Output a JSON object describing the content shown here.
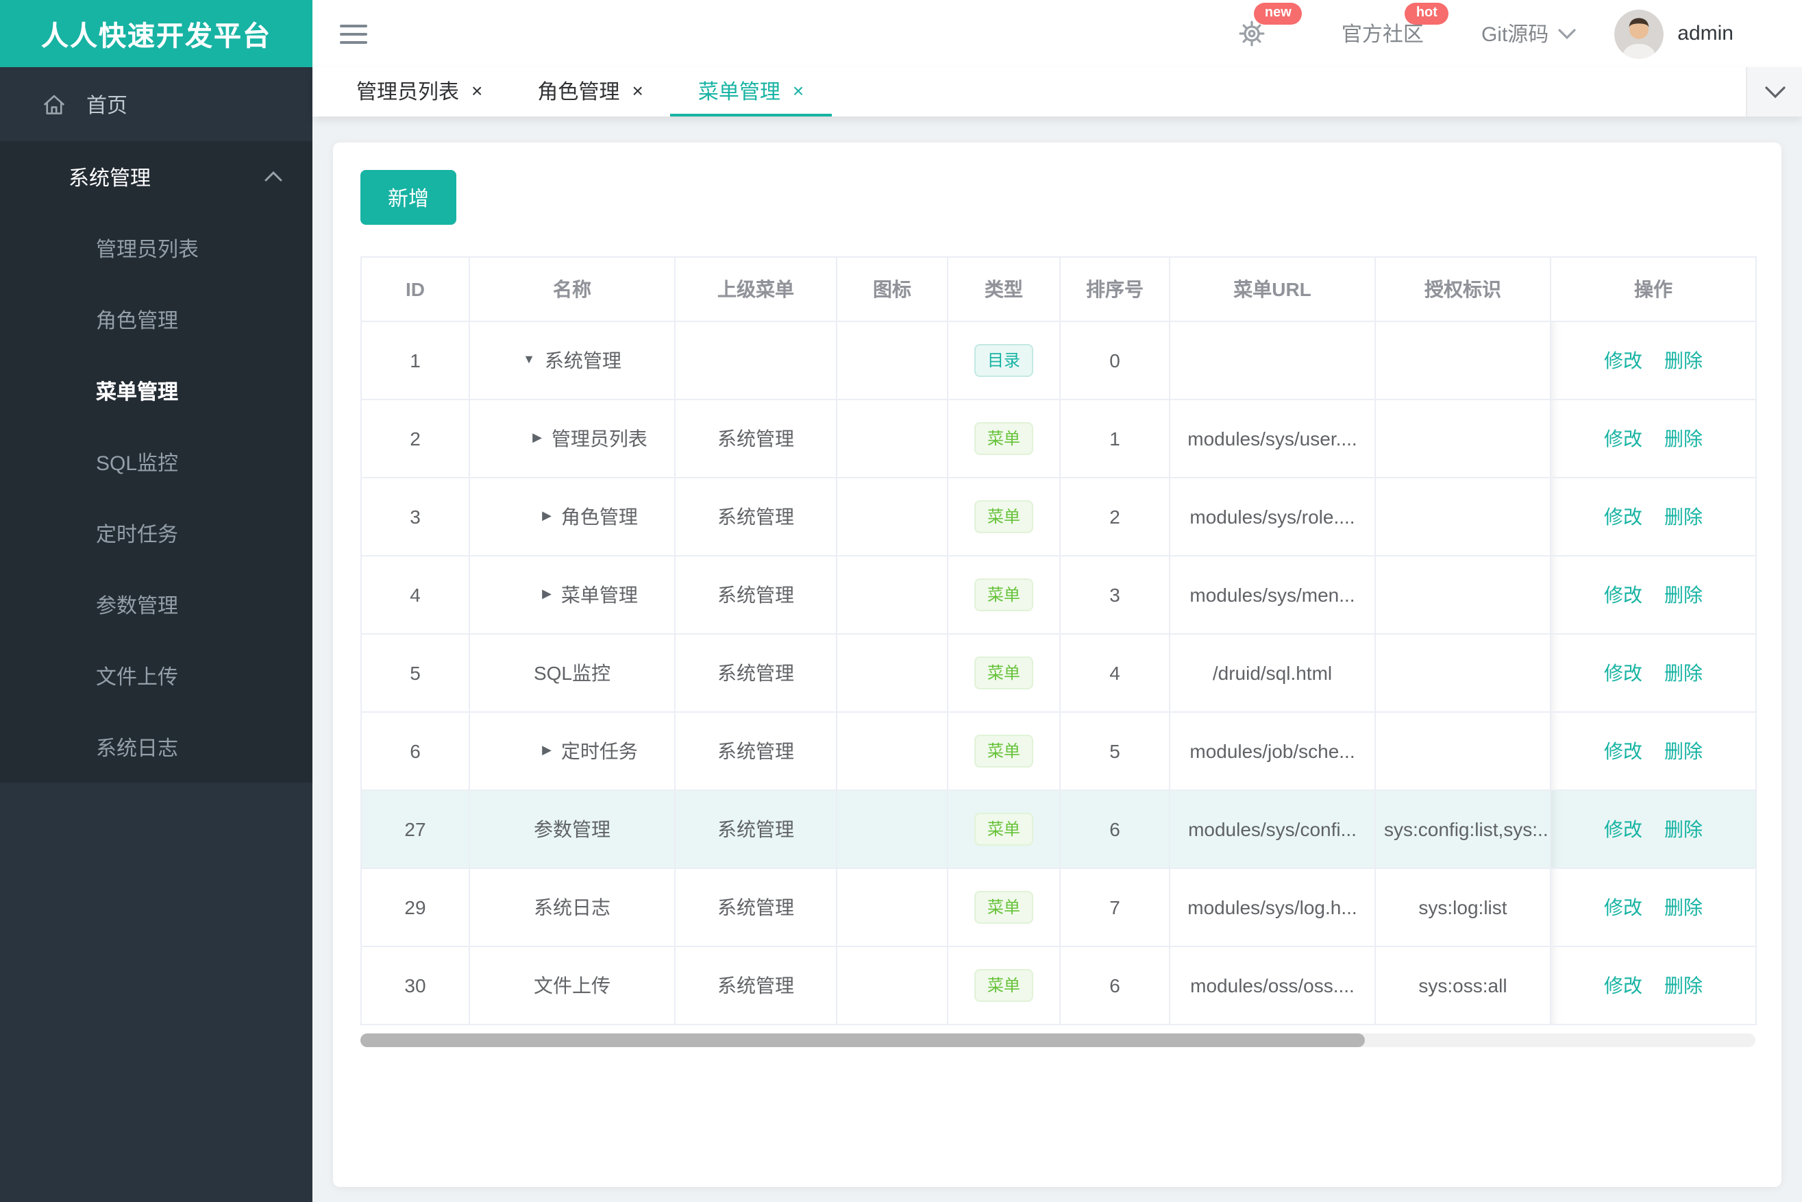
{
  "app": {
    "title": "人人快速开发平台"
  },
  "topbar": {
    "badge_new": "new",
    "community_label": "官方社区",
    "badge_hot": "hot",
    "git_label": "Git源码",
    "username": "admin"
  },
  "tabs": [
    {
      "label": "管理员列表",
      "active": false
    },
    {
      "label": "角色管理",
      "active": false
    },
    {
      "label": "菜单管理",
      "active": true
    }
  ],
  "sidebar": {
    "home_label": "首页",
    "group_label": "系统管理",
    "items": [
      "管理员列表",
      "角色管理",
      "菜单管理",
      "SQL监控",
      "定时任务",
      "参数管理",
      "文件上传",
      "系统日志"
    ],
    "active_item": "菜单管理"
  },
  "toolbar": {
    "add_label": "新增"
  },
  "actions": {
    "edit": "修改",
    "delete": "删除"
  },
  "glyphs": {
    "close": "×",
    "expanded": "▼",
    "collapsed": "▶"
  },
  "table": {
    "columns": [
      {
        "label": "ID",
        "width": 79
      },
      {
        "label": "名称",
        "width": 150
      },
      {
        "label": "上级菜单",
        "width": 118
      },
      {
        "label": "图标",
        "width": 81
      },
      {
        "label": "类型",
        "width": 82
      },
      {
        "label": "排序号",
        "width": 80
      },
      {
        "label": "菜单URL",
        "width": 150
      },
      {
        "label": "授权标识",
        "width": 128
      },
      {
        "label": "操作",
        "width": 150
      }
    ],
    "rows": [
      {
        "id": "1",
        "expand": "expanded",
        "name": "系统管理",
        "parent": "",
        "icon": "",
        "type": "目录",
        "type_variant": "dir",
        "order": "0",
        "url": "",
        "perms": "",
        "highlighted": false
      },
      {
        "id": "2",
        "expand": "collapsed",
        "name": "管理员列表",
        "parent": "系统管理",
        "icon": "",
        "type": "菜单",
        "type_variant": "menu",
        "order": "1",
        "url": "modules/sys/user....",
        "perms": "",
        "highlighted": false
      },
      {
        "id": "3",
        "expand": "collapsed",
        "name": "角色管理",
        "parent": "系统管理",
        "icon": "",
        "type": "菜单",
        "type_variant": "menu",
        "order": "2",
        "url": "modules/sys/role....",
        "perms": "",
        "highlighted": false
      },
      {
        "id": "4",
        "expand": "collapsed",
        "name": "菜单管理",
        "parent": "系统管理",
        "icon": "",
        "type": "菜单",
        "type_variant": "menu",
        "order": "3",
        "url": "modules/sys/men...",
        "perms": "",
        "highlighted": false
      },
      {
        "id": "5",
        "expand": "none",
        "name": "SQL监控",
        "parent": "系统管理",
        "icon": "",
        "type": "菜单",
        "type_variant": "menu",
        "order": "4",
        "url": "/druid/sql.html",
        "perms": "",
        "highlighted": false
      },
      {
        "id": "6",
        "expand": "collapsed",
        "name": "定时任务",
        "parent": "系统管理",
        "icon": "",
        "type": "菜单",
        "type_variant": "menu",
        "order": "5",
        "url": "modules/job/sche...",
        "perms": "",
        "highlighted": false
      },
      {
        "id": "27",
        "expand": "none",
        "name": "参数管理",
        "parent": "系统管理",
        "icon": "",
        "type": "菜单",
        "type_variant": "menu",
        "order": "6",
        "url": "modules/sys/confi...",
        "perms": "sys:config:list,sys:...",
        "highlighted": true
      },
      {
        "id": "29",
        "expand": "none",
        "name": "系统日志",
        "parent": "系统管理",
        "icon": "",
        "type": "菜单",
        "type_variant": "menu",
        "order": "7",
        "url": "modules/sys/log.h...",
        "perms": "sys:log:list",
        "highlighted": false
      },
      {
        "id": "30",
        "expand": "none",
        "name": "文件上传",
        "parent": "系统管理",
        "icon": "",
        "type": "菜单",
        "type_variant": "menu",
        "order": "6",
        "url": "modules/oss/oss....",
        "perms": "sys:oss:all",
        "highlighted": false
      }
    ]
  },
  "scrollbar": {
    "thumb_percent": 72
  },
  "colors": {
    "brand_teal": "#17b3a3",
    "badge_red": "#f76c6c",
    "tag_dir_green": "#17b3a3",
    "tag_menu_green": "#67c23a",
    "row_highlight": "#e9f6f5",
    "sidebar_bg": "#2a343e",
    "sidebar_group_bg": "#232b33"
  }
}
